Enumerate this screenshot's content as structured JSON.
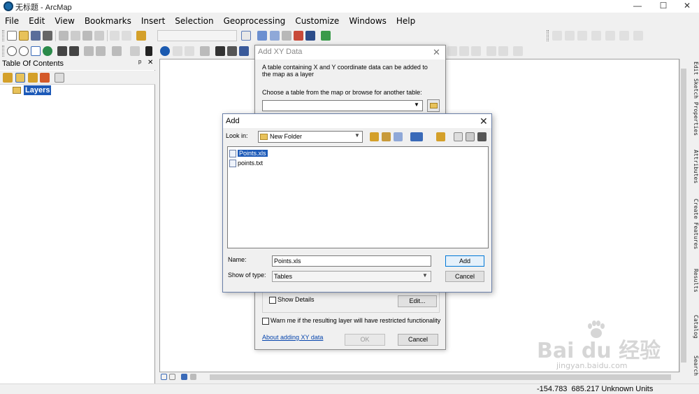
{
  "window": {
    "title": "无标题 - ArcMap",
    "minimize": "—",
    "maximize": "☐",
    "close": "✕"
  },
  "menu": {
    "items": [
      {
        "label": "File"
      },
      {
        "label": "Edit"
      },
      {
        "label": "View"
      },
      {
        "label": "Bookmarks"
      },
      {
        "label": "Insert"
      },
      {
        "label": "Selection"
      },
      {
        "label": "Geoprocessing"
      },
      {
        "label": "Customize"
      },
      {
        "label": "Windows"
      },
      {
        "label": "Help"
      }
    ]
  },
  "toc": {
    "title": "Table Of Contents",
    "pin": "ᵖ",
    "close": "✕",
    "layers_label": "Layers"
  },
  "xy_dialog": {
    "title": "Add XY Data",
    "close": "✕",
    "description": "A table containing X and Y coordinate data can be added to the map as a layer",
    "choose_label": "Choose a table from the map or browse for another table:",
    "show_details": "Show Details",
    "edit_button": "Edit...",
    "warn_label": "Warn me if the resulting layer will have restricted functionality",
    "about_link": "About adding XY data",
    "ok_button": "OK",
    "cancel_button": "Cancel"
  },
  "add_dialog": {
    "title": "Add",
    "close": "✕",
    "look_in_label": "Look in:",
    "look_in_value": "New Folder",
    "files": [
      {
        "name": "Points.xls",
        "selected": true
      },
      {
        "name": "points.txt",
        "selected": false
      }
    ],
    "name_label": "Name:",
    "name_value": "Points.xls",
    "type_label": "Show of type:",
    "type_value": "Tables",
    "add_button": "Add",
    "cancel_button": "Cancel"
  },
  "dock_tabs": [
    {
      "label": "Edit Sketch Properties"
    },
    {
      "label": "Attributes"
    },
    {
      "label": "Create Features"
    },
    {
      "label": "Results"
    },
    {
      "label": "Catalog"
    },
    {
      "label": "Search"
    }
  ],
  "status": {
    "coordinates": "-154.783  685.217 Unknown Units"
  },
  "watermark": {
    "text": "Bai du 经验",
    "sub": "jingyan.baidu.com"
  },
  "colors": {
    "selection": "#1d5ab8",
    "accent": "#0078d7"
  }
}
